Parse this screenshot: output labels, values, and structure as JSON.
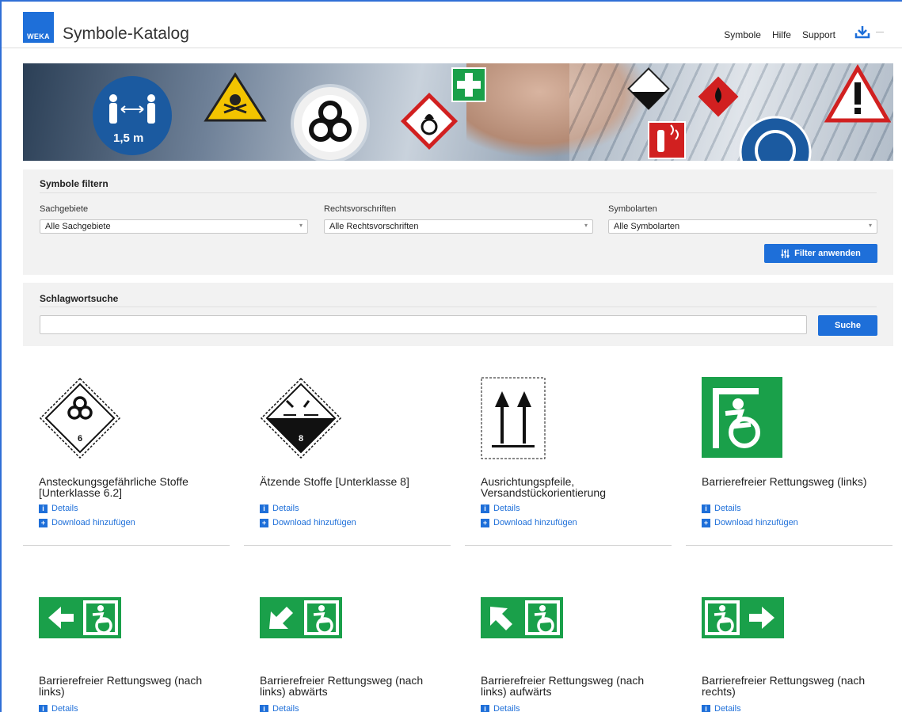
{
  "header": {
    "logo_text": "WEKA",
    "title": "Symbole-Katalog",
    "nav": [
      "Symbole",
      "Hilfe",
      "Support"
    ],
    "download_icon": "download-icon"
  },
  "banner": {
    "distance_text": "1,5 m"
  },
  "filter": {
    "title": "Symbole filtern",
    "fields": [
      {
        "label": "Sachgebiete",
        "value": "Alle Sachgebiete"
      },
      {
        "label": "Rechtsvorschriften",
        "value": "Alle Rechtsvorschriften"
      },
      {
        "label": "Symbolarten",
        "value": "Alle Symbolarten"
      }
    ],
    "apply_label": "Filter anwenden"
  },
  "search": {
    "title": "Schlagwortsuche",
    "value": "",
    "button_label": "Suche"
  },
  "symbols": [
    {
      "name": "Ansteckungsgefährliche Stoffe [Unterklasse 6.2]",
      "sign_text": "6"
    },
    {
      "name": "Ätzende Stoffe [Unterklasse 8]",
      "sign_text": "8"
    },
    {
      "name": "Ausrichtungspfeile, Versandstückorientierung"
    },
    {
      "name": "Barrierefreier Rettungsweg (links)"
    },
    {
      "name": "Barrierefreier Rettungsweg (nach links)"
    },
    {
      "name": "Barrierefreier Rettungsweg (nach links) abwärts"
    },
    {
      "name": "Barrierefreier Rettungsweg (nach links) aufwärts"
    },
    {
      "name": "Barrierefreier Rettungsweg (nach rechts)"
    }
  ],
  "card_links": {
    "details": "Details",
    "download": "Download hinzufügen"
  },
  "colors": {
    "accent": "#1e6fd9",
    "escape_green": "#1aa04a",
    "panel_bg": "#f2f2f2"
  }
}
